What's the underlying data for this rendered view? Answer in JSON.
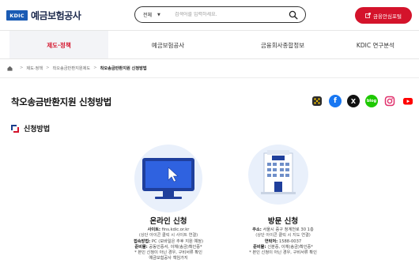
{
  "header": {
    "logo_badge": "KDIC",
    "logo_text": "예금보험공사",
    "search": {
      "select_value": "전체",
      "placeholder": "검색어를 입력하세요."
    },
    "red_button_label": "금융안심포털"
  },
  "nav": {
    "items": [
      {
        "label": "제도·정책",
        "active": true
      },
      {
        "label": "예금보험공사",
        "active": false
      },
      {
        "label": "금융회사종합정보",
        "active": false
      },
      {
        "label": "KDIC 연구분석",
        "active": false
      }
    ]
  },
  "breadcrumb": [
    "제도·정책",
    "착오송금반환지원제도",
    "착오송금반환지원 신청방법"
  ],
  "page_title": "착오송금반환지원 신청방법",
  "social": [
    {
      "name": "share-icon",
      "color": "#2b2b2b"
    },
    {
      "name": "facebook-icon",
      "color": "#1877f2",
      "glyph": "f"
    },
    {
      "name": "x-icon",
      "color": "#111111",
      "glyph": "X"
    },
    {
      "name": "blog-icon",
      "color": "#1ec800",
      "glyph": "blog"
    },
    {
      "name": "instagram-icon",
      "color": "#e1306c"
    },
    {
      "name": "youtube-icon",
      "color": "#ff0000"
    }
  ],
  "section_title": "신청방법",
  "online": {
    "title": "온라인 신청",
    "site_label": "사이트:",
    "site_value": "fins.kdic.or.kr",
    "site_note": "(상단 아이콘 클릭 시 사이트 연결)",
    "method_label": "접속방법:",
    "method_value": "PC (모바일은 추후 지원 예정)",
    "prep_label": "준비물:",
    "prep_value": "공동인증서, 이체(송금)확인증*",
    "note_1": "* 본인 신청이 아닌 경우, 구비서류 확인",
    "note_2": "예금보험공사 책임가지"
  },
  "visit": {
    "title": "방문 신청",
    "addr_label": "주소:",
    "addr_value": "서울시 중구 청계천로 30 1층",
    "addr_note": "(상단 아이콘 클릭 시 지도 연결)",
    "phone_label": "연락처:",
    "phone_value": "1588-0037",
    "prep_label": "준비물:",
    "prep_value": "신분증, 이체(송금)확인증*",
    "note_1": "* 본인 신청이 아닌 경우, 구비서류 확인"
  }
}
